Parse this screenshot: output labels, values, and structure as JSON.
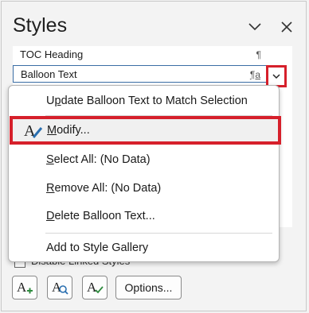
{
  "pane": {
    "title": "Styles"
  },
  "style_list": [
    {
      "name": "TOC Heading",
      "mark": "¶"
    },
    {
      "name": "Balloon Text",
      "mark": "¶a"
    }
  ],
  "context_menu": {
    "items": [
      {
        "label": "Update Balloon Text to Match Selection",
        "underline": "p"
      },
      {
        "label": "Modify...",
        "underline": "M"
      },
      {
        "label": "Select All: (No Data)",
        "underline": "S"
      },
      {
        "label": "Remove All: (No Data)",
        "underline": "R"
      },
      {
        "label": "Delete Balloon Text...",
        "underline": "D"
      },
      {
        "label": "Add to Style Gallery",
        "underline": ""
      }
    ]
  },
  "footer": {
    "checkbox_label": "Disable Linked Styles",
    "options_label": "Options..."
  },
  "colors": {
    "highlight_red": "#d6202b",
    "selection_border": "#3a6ea5",
    "pane_bg": "#f3f3f3"
  },
  "icons": [
    "chevron-down-icon",
    "close-icon",
    "modify-style-icon",
    "new-style-icon",
    "style-inspector-icon",
    "manage-styles-icon"
  ]
}
